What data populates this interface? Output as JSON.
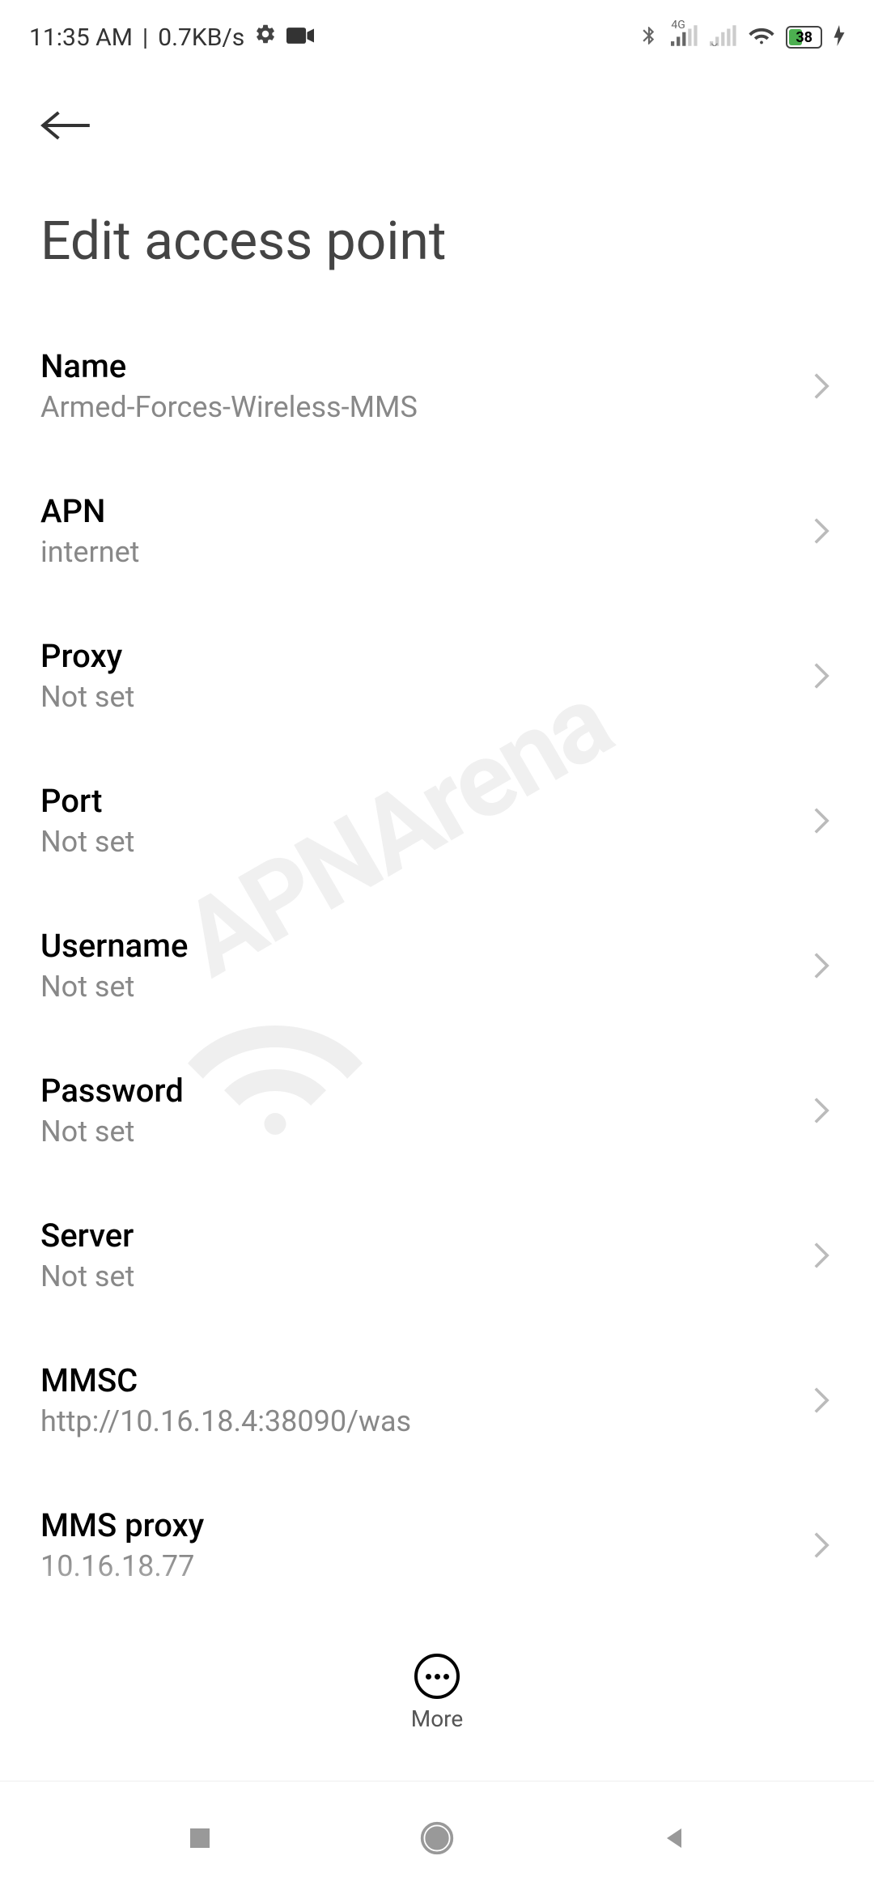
{
  "statusBar": {
    "time": "11:35 AM",
    "network": "0.7KB/s",
    "signal4g": "4G",
    "batteryPercent": "38"
  },
  "header": {
    "title": "Edit access point"
  },
  "settings": [
    {
      "label": "Name",
      "value": "Armed-Forces-Wireless-MMS"
    },
    {
      "label": "APN",
      "value": "internet"
    },
    {
      "label": "Proxy",
      "value": "Not set"
    },
    {
      "label": "Port",
      "value": "Not set"
    },
    {
      "label": "Username",
      "value": "Not set"
    },
    {
      "label": "Password",
      "value": "Not set"
    },
    {
      "label": "Server",
      "value": "Not set"
    },
    {
      "label": "MMSC",
      "value": "http://10.16.18.4:38090/was"
    },
    {
      "label": "MMS proxy",
      "value": "10.16.18.77"
    }
  ],
  "bottom": {
    "moreLabel": "More"
  },
  "watermark": "APNArena"
}
